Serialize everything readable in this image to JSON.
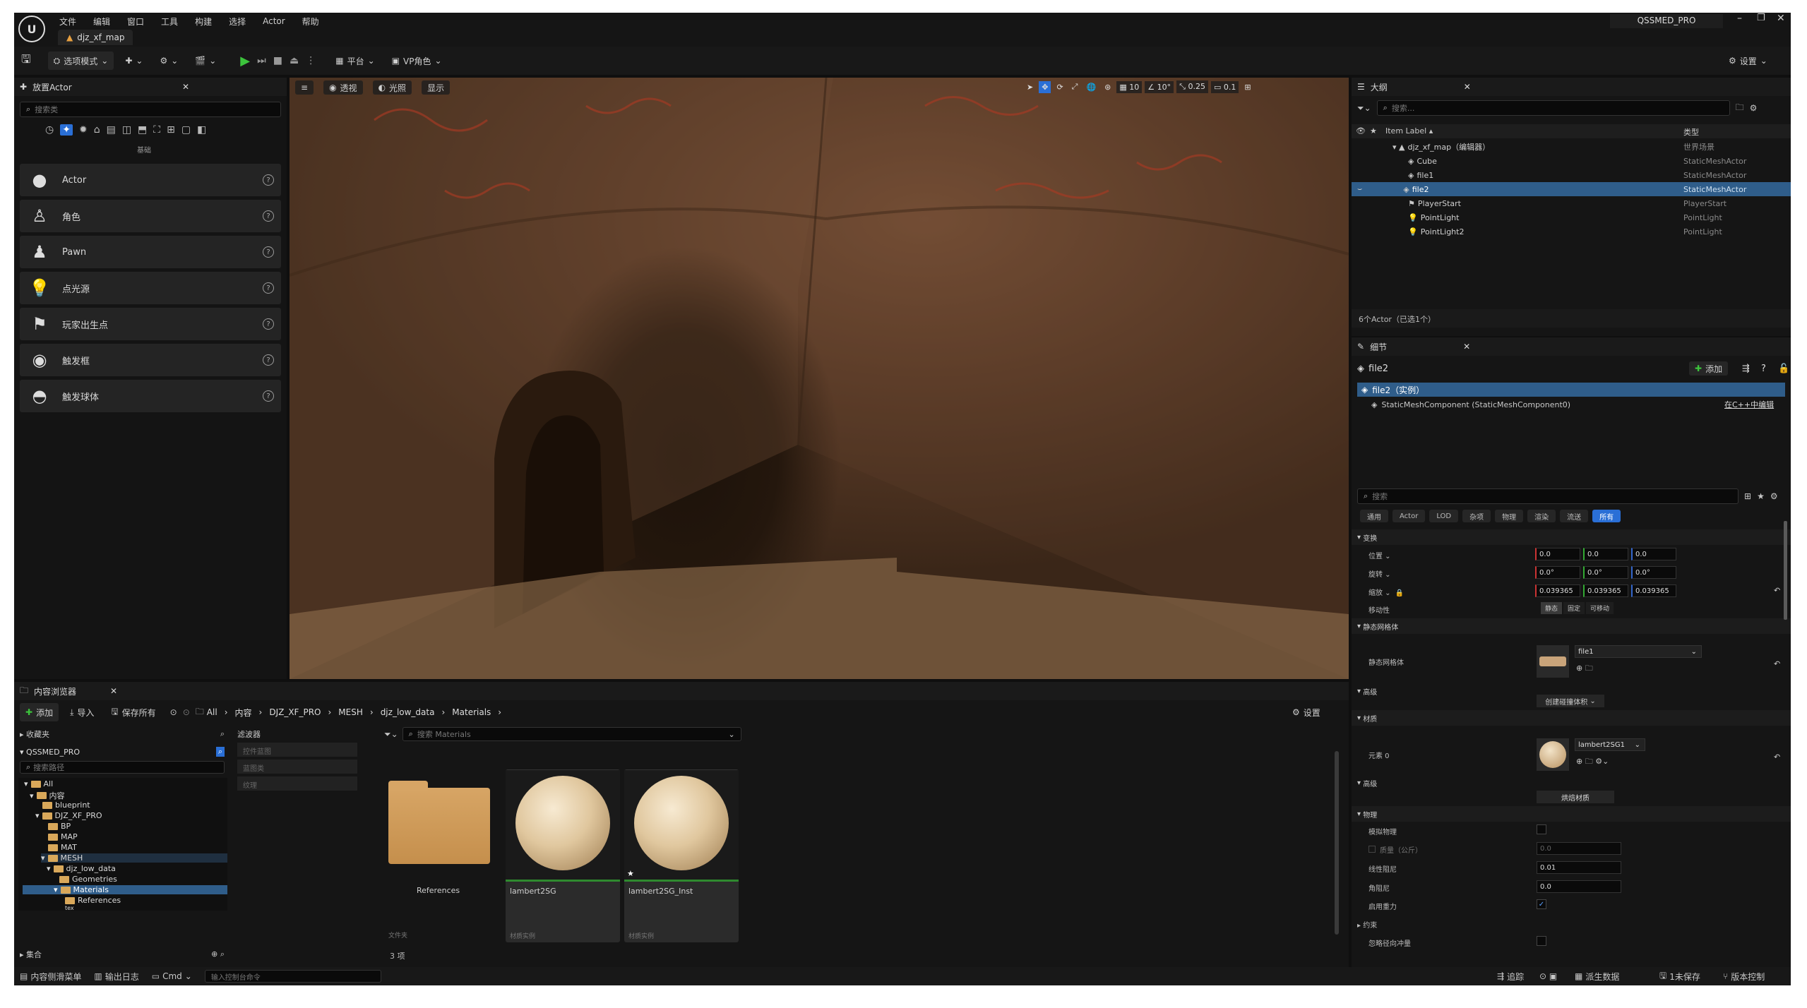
{
  "menu": {
    "items": [
      "文件",
      "编辑",
      "窗口",
      "工具",
      "构建",
      "选择",
      "Actor",
      "帮助"
    ],
    "project": "QSSMED_PRO",
    "map_tab": "djz_xf_map"
  },
  "toolbar": {
    "mode": "选项模式",
    "platform": "平台",
    "vp": "VP角色",
    "settings": "设置"
  },
  "viewport": {
    "view_label": "透视",
    "lit_label": "光照",
    "show_label": "显示",
    "grid": "10",
    "angle": "10°",
    "scale": "0.25",
    "camera_speed": "0.1"
  },
  "place_actors": {
    "title": "放置Actor",
    "search_placeholder": "搜索类",
    "category": "基础",
    "items": [
      "Actor",
      "角色",
      "Pawn",
      "点光源",
      "玩家出生点",
      "触发框",
      "触发球体"
    ]
  },
  "outliner": {
    "title": "大纲",
    "search_placeholder": "搜索...",
    "col_label": "Item Label ▴",
    "col_type": "类型",
    "rows": [
      {
        "label": "djz_xf_map（编辑器）",
        "type": "世界场景"
      },
      {
        "label": "Cube",
        "type": "StaticMeshActor"
      },
      {
        "label": "file1",
        "type": "StaticMeshActor"
      },
      {
        "label": "file2",
        "type": "StaticMeshActor"
      },
      {
        "label": "PlayerStart",
        "type": "PlayerStart"
      },
      {
        "label": "PointLight",
        "type": "PointLight"
      },
      {
        "label": "PointLight2",
        "type": "PointLight"
      }
    ],
    "status": "6个Actor（已选1个）"
  },
  "details": {
    "title": "细节",
    "object": "file2",
    "add": "添加",
    "instance": "file2（实例）",
    "component": "StaticMeshComponent (StaticMeshComponent0)",
    "edit_cpp": "在C++中编辑",
    "search_placeholder": "搜索",
    "filter_tabs": [
      "通用",
      "Actor",
      "LOD",
      "杂项",
      "物理",
      "渲染",
      "流送",
      "所有"
    ],
    "transform_sec": "变换",
    "location": "位置",
    "rotation": "旋转",
    "scale": "缩放",
    "mobility": "移动性",
    "loc": [
      "0.0",
      "0.0",
      "0.0"
    ],
    "rot": [
      "0.0°",
      "0.0°",
      "0.0°"
    ],
    "scl": [
      "0.039365",
      "0.039365",
      "0.039365"
    ],
    "mob_opts": [
      "静态",
      "固定",
      "可移动"
    ],
    "static_mesh_sec": "静态网格体",
    "static_mesh_lbl": "静态网格体",
    "mesh_value": "file1",
    "advanced": "高级",
    "create_btn": "创建碰撞体积",
    "materials_sec": "材质",
    "element0": "元素 0",
    "material_value": "lambert2SG1",
    "advanced2": "高级",
    "bake_btn": "烘焙材质",
    "physics_sec": "物理",
    "simulate": "模拟物理",
    "mass": "质量（公斤）",
    "mass_val": "0.0",
    "linear_damping": "线性阻尼",
    "linear_damping_val": "0.01",
    "angular_damping": "角阻尼",
    "angular_damping_val": "0.0",
    "gravity": "启用重力",
    "constraints": "约束",
    "impulse": "忽略径向冲量"
  },
  "content_browser": {
    "title": "内容浏览器",
    "add": "添加",
    "import": "导入",
    "save_all": "保存所有",
    "path": [
      "All",
      "内容",
      "DJZ_XF_PRO",
      "MESH",
      "djz_low_data",
      "Materials"
    ],
    "settings": "设置",
    "favorites": "收藏夹",
    "project": "QSSMED_PRO",
    "search_path_placeholder": "搜索路径",
    "filters": "滤波器",
    "filter_items": [
      "控件蓝图",
      "蓝图类",
      "纹理"
    ],
    "search_placeholder": "搜索 Materials",
    "collections": "集合",
    "count": "3 项",
    "tree": [
      "All",
      "内容",
      "blueprint",
      "DJZ_XF_PRO",
      "BP",
      "MAP",
      "MAT",
      "MESH",
      "djz_low_data",
      "Geometries",
      "Materials",
      "References",
      "tex"
    ],
    "assets": [
      {
        "name": "References",
        "type": "文件夹"
      },
      {
        "name": "lambert2SG",
        "type": "材质实例"
      },
      {
        "name": "lambert2SG_Inst",
        "type": "材质实例"
      }
    ]
  },
  "statusbar": {
    "drawer": "内容侧滑菜单",
    "output": "输出日志",
    "cmd": "Cmd",
    "cmd_placeholder": "输入控制台命令",
    "trace": "追踪",
    "derived": "派生数据",
    "unsaved": "1未保存",
    "source": "版本控制"
  }
}
